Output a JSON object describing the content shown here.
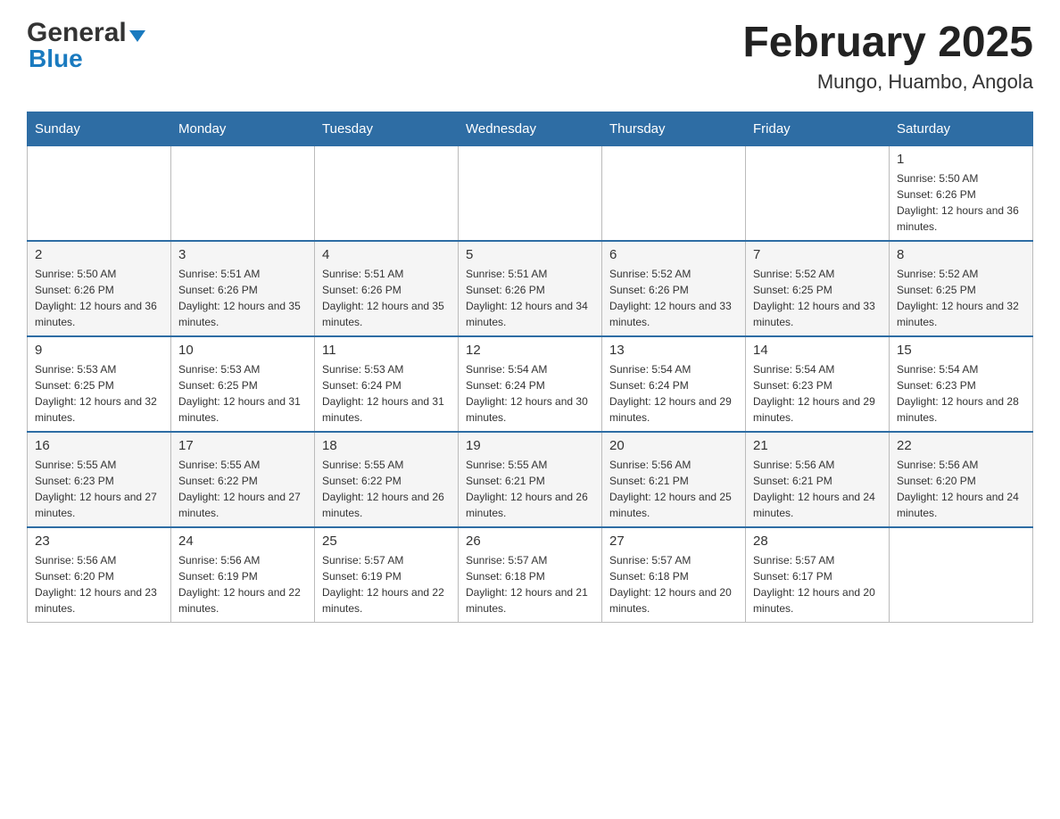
{
  "header": {
    "logo_general": "General",
    "logo_blue": "Blue",
    "title": "February 2025",
    "subtitle": "Mungo, Huambo, Angola"
  },
  "days_of_week": [
    "Sunday",
    "Monday",
    "Tuesday",
    "Wednesday",
    "Thursday",
    "Friday",
    "Saturday"
  ],
  "weeks": [
    [
      {
        "day": "",
        "info": ""
      },
      {
        "day": "",
        "info": ""
      },
      {
        "day": "",
        "info": ""
      },
      {
        "day": "",
        "info": ""
      },
      {
        "day": "",
        "info": ""
      },
      {
        "day": "",
        "info": ""
      },
      {
        "day": "1",
        "info": "Sunrise: 5:50 AM\nSunset: 6:26 PM\nDaylight: 12 hours and 36 minutes."
      }
    ],
    [
      {
        "day": "2",
        "info": "Sunrise: 5:50 AM\nSunset: 6:26 PM\nDaylight: 12 hours and 36 minutes."
      },
      {
        "day": "3",
        "info": "Sunrise: 5:51 AM\nSunset: 6:26 PM\nDaylight: 12 hours and 35 minutes."
      },
      {
        "day": "4",
        "info": "Sunrise: 5:51 AM\nSunset: 6:26 PM\nDaylight: 12 hours and 35 minutes."
      },
      {
        "day": "5",
        "info": "Sunrise: 5:51 AM\nSunset: 6:26 PM\nDaylight: 12 hours and 34 minutes."
      },
      {
        "day": "6",
        "info": "Sunrise: 5:52 AM\nSunset: 6:26 PM\nDaylight: 12 hours and 33 minutes."
      },
      {
        "day": "7",
        "info": "Sunrise: 5:52 AM\nSunset: 6:25 PM\nDaylight: 12 hours and 33 minutes."
      },
      {
        "day": "8",
        "info": "Sunrise: 5:52 AM\nSunset: 6:25 PM\nDaylight: 12 hours and 32 minutes."
      }
    ],
    [
      {
        "day": "9",
        "info": "Sunrise: 5:53 AM\nSunset: 6:25 PM\nDaylight: 12 hours and 32 minutes."
      },
      {
        "day": "10",
        "info": "Sunrise: 5:53 AM\nSunset: 6:25 PM\nDaylight: 12 hours and 31 minutes."
      },
      {
        "day": "11",
        "info": "Sunrise: 5:53 AM\nSunset: 6:24 PM\nDaylight: 12 hours and 31 minutes."
      },
      {
        "day": "12",
        "info": "Sunrise: 5:54 AM\nSunset: 6:24 PM\nDaylight: 12 hours and 30 minutes."
      },
      {
        "day": "13",
        "info": "Sunrise: 5:54 AM\nSunset: 6:24 PM\nDaylight: 12 hours and 29 minutes."
      },
      {
        "day": "14",
        "info": "Sunrise: 5:54 AM\nSunset: 6:23 PM\nDaylight: 12 hours and 29 minutes."
      },
      {
        "day": "15",
        "info": "Sunrise: 5:54 AM\nSunset: 6:23 PM\nDaylight: 12 hours and 28 minutes."
      }
    ],
    [
      {
        "day": "16",
        "info": "Sunrise: 5:55 AM\nSunset: 6:23 PM\nDaylight: 12 hours and 27 minutes."
      },
      {
        "day": "17",
        "info": "Sunrise: 5:55 AM\nSunset: 6:22 PM\nDaylight: 12 hours and 27 minutes."
      },
      {
        "day": "18",
        "info": "Sunrise: 5:55 AM\nSunset: 6:22 PM\nDaylight: 12 hours and 26 minutes."
      },
      {
        "day": "19",
        "info": "Sunrise: 5:55 AM\nSunset: 6:21 PM\nDaylight: 12 hours and 26 minutes."
      },
      {
        "day": "20",
        "info": "Sunrise: 5:56 AM\nSunset: 6:21 PM\nDaylight: 12 hours and 25 minutes."
      },
      {
        "day": "21",
        "info": "Sunrise: 5:56 AM\nSunset: 6:21 PM\nDaylight: 12 hours and 24 minutes."
      },
      {
        "day": "22",
        "info": "Sunrise: 5:56 AM\nSunset: 6:20 PM\nDaylight: 12 hours and 24 minutes."
      }
    ],
    [
      {
        "day": "23",
        "info": "Sunrise: 5:56 AM\nSunset: 6:20 PM\nDaylight: 12 hours and 23 minutes."
      },
      {
        "day": "24",
        "info": "Sunrise: 5:56 AM\nSunset: 6:19 PM\nDaylight: 12 hours and 22 minutes."
      },
      {
        "day": "25",
        "info": "Sunrise: 5:57 AM\nSunset: 6:19 PM\nDaylight: 12 hours and 22 minutes."
      },
      {
        "day": "26",
        "info": "Sunrise: 5:57 AM\nSunset: 6:18 PM\nDaylight: 12 hours and 21 minutes."
      },
      {
        "day": "27",
        "info": "Sunrise: 5:57 AM\nSunset: 6:18 PM\nDaylight: 12 hours and 20 minutes."
      },
      {
        "day": "28",
        "info": "Sunrise: 5:57 AM\nSunset: 6:17 PM\nDaylight: 12 hours and 20 minutes."
      },
      {
        "day": "",
        "info": ""
      }
    ]
  ]
}
